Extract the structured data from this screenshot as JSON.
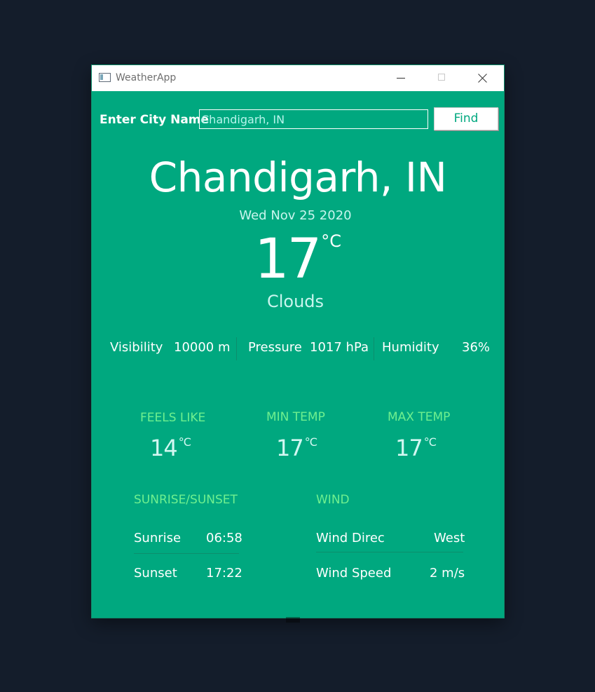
{
  "window": {
    "title": "WeatherApp",
    "background": "#00a87f"
  },
  "search": {
    "label": "Enter City Name",
    "value": "Chandigarh, IN",
    "button_label": "Find"
  },
  "current": {
    "city": "Chandigarh, IN",
    "date": "Wed Nov 25 2020",
    "temperature": "17",
    "unit": "°C",
    "condition": "Clouds"
  },
  "stats": [
    {
      "label": "Visibility",
      "value": "10000 m"
    },
    {
      "label": "Pressure",
      "value": "1017 hPa"
    },
    {
      "label": "Humidity",
      "value": "36%"
    }
  ],
  "metrics": [
    {
      "label": "FEELS LIKE",
      "value": "14",
      "unit": "°C"
    },
    {
      "label": "MIN TEMP",
      "value": "17",
      "unit": "°C"
    },
    {
      "label": "MAX TEMP",
      "value": "17",
      "unit": "°C"
    }
  ],
  "sun": {
    "title": "SUNRISE/SUNSET",
    "rows": [
      {
        "label": "Sunrise",
        "value": "06:58"
      },
      {
        "label": "Sunset",
        "value": "17:22"
      }
    ]
  },
  "wind": {
    "title": "WIND",
    "rows": [
      {
        "label": "Wind Direc",
        "value": "West"
      },
      {
        "label": "Wind Speed",
        "value": "2 m/s"
      }
    ]
  },
  "colors": {
    "accent": "#00a87f",
    "label_green": "#6ff08f",
    "text_light": "#c9f5ee"
  }
}
